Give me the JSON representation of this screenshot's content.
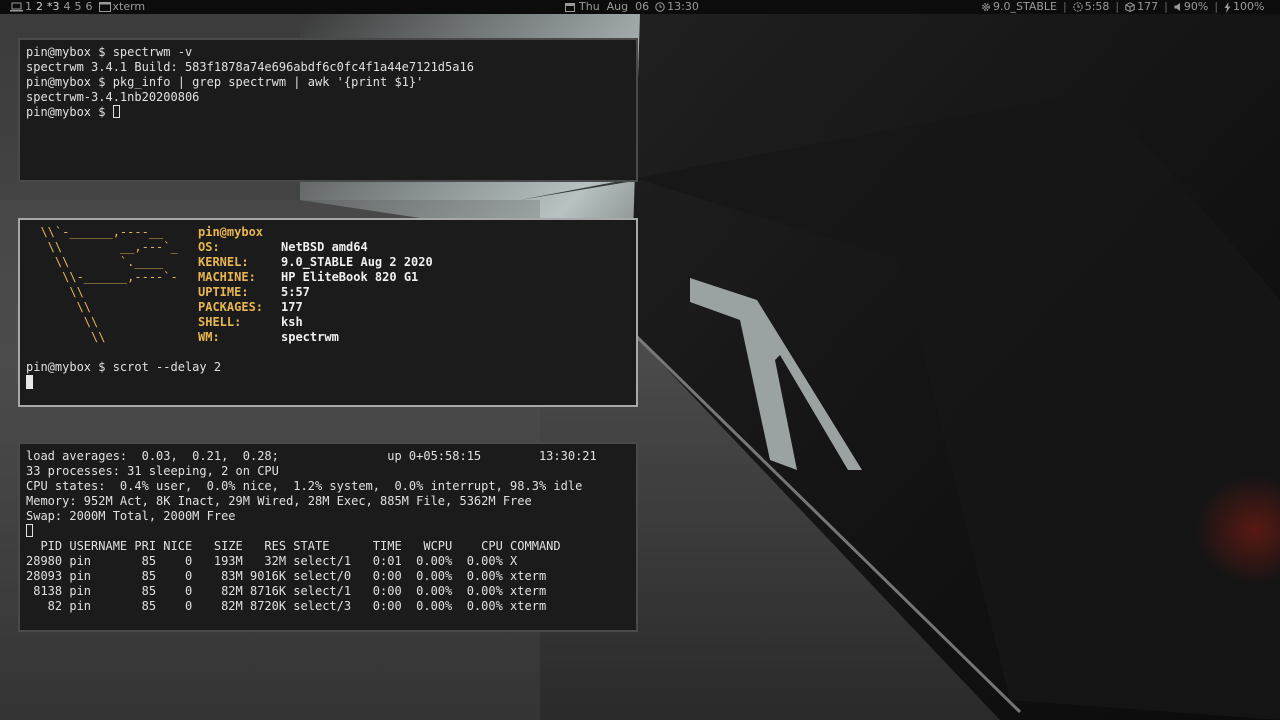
{
  "topbar": {
    "workspaces": [
      "1",
      "2",
      "*3",
      "4",
      "5",
      "6"
    ],
    "window_title": "xterm",
    "date": "Thu  Aug  06",
    "time": "13:30",
    "os_version": "9.0_STABLE",
    "uptime": "5:58",
    "packages": "177",
    "volume": "90%",
    "battery": "100%"
  },
  "term1": {
    "lines": [
      "pin@mybox $ spectrwm -v",
      "spectrwm 3.4.1 Build: 583f1878a74e696abdf6c0fc4f1a44e7121d5a16",
      "pin@mybox $ pkg_info | grep spectrwm | awk '{print $1}'",
      "spectrwm-3.4.1nb20200806",
      "pin@mybox $ "
    ]
  },
  "term2": {
    "logo": [
      "  \\\\`-______,----__",
      "   \\\\        __,---`_",
      "    \\\\       `.____",
      "     \\\\-______,----`-",
      "      \\\\",
      "       \\\\",
      "        \\\\",
      "         \\\\"
    ],
    "user": "pin@mybox",
    "info": [
      {
        "key": "OS:",
        "value": "NetBSD amd64"
      },
      {
        "key": "KERNEL:",
        "value": "9.0_STABLE Aug 2 2020"
      },
      {
        "key": "MACHINE:",
        "value": "HP EliteBook 820 G1"
      },
      {
        "key": "UPTIME:",
        "value": "5:57"
      },
      {
        "key": "PACKAGES:",
        "value": "177"
      },
      {
        "key": "SHELL:",
        "value": "ksh"
      },
      {
        "key": "WM:",
        "value": "spectrwm"
      }
    ],
    "prompt": "pin@mybox $ scrot --delay 2"
  },
  "term3": {
    "header": [
      "load averages:  0.03,  0.21,  0.28;               up 0+05:58:15        13:30:21",
      "33 processes: 31 sleeping, 2 on CPU",
      "CPU states:  0.4% user,  0.0% nice,  1.2% system,  0.0% interrupt, 98.3% idle",
      "Memory: 952M Act, 8K Inact, 29M Wired, 28M Exec, 885M File, 5362M Free",
      "Swap: 2000M Total, 2000M Free"
    ],
    "table_header": "  PID USERNAME PRI NICE   SIZE   RES STATE      TIME   WCPU    CPU COMMAND",
    "rows": [
      "28980 pin       85    0   193M   32M select/1   0:01  0.00%  0.00% X",
      "28093 pin       85    0    83M 9016K select/0   0:00  0.00%  0.00% xterm",
      " 8138 pin       85    0    82M 8716K select/1   0:00  0.00%  0.00% xterm",
      "   82 pin       85    0    82M 8720K select/3   0:00  0.00%  0.00% xterm"
    ]
  }
}
